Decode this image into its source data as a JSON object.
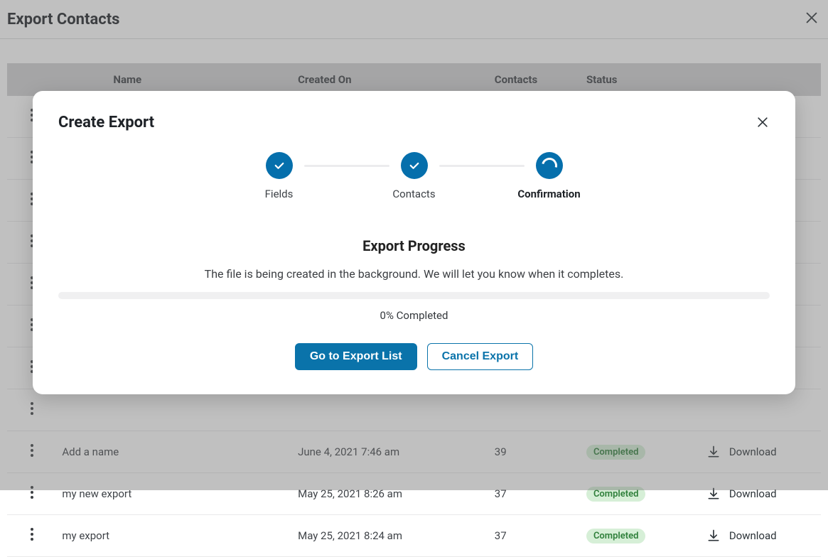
{
  "page": {
    "title": "Export Contacts"
  },
  "table": {
    "headers": {
      "name": "Name",
      "created": "Created On",
      "contacts": "Contacts",
      "status": "Status"
    },
    "rows": [
      {
        "name": "",
        "created": "",
        "contacts": "",
        "status": "",
        "download": ""
      },
      {
        "name": "",
        "created": "",
        "contacts": "",
        "status": "",
        "download": ""
      },
      {
        "name": "",
        "created": "",
        "contacts": "",
        "status": "",
        "download": ""
      },
      {
        "name": "",
        "created": "",
        "contacts": "",
        "status": "",
        "download": ""
      },
      {
        "name": "",
        "created": "",
        "contacts": "",
        "status": "",
        "download": ""
      },
      {
        "name": "",
        "created": "",
        "contacts": "",
        "status": "",
        "download": ""
      },
      {
        "name": "",
        "created": "",
        "contacts": "",
        "status": "",
        "download": ""
      },
      {
        "name": "",
        "created": "",
        "contacts": "",
        "status": "",
        "download": ""
      },
      {
        "name": "Add a name",
        "created": "June 4, 2021 7:46 am",
        "contacts": "39",
        "status": "Completed",
        "download": "Download"
      },
      {
        "name": "my new export",
        "created": "May 25, 2021 8:26 am",
        "contacts": "37",
        "status": "Completed",
        "download": "Download"
      },
      {
        "name": "my export",
        "created": "May 25, 2021 8:24 am",
        "contacts": "37",
        "status": "Completed",
        "download": "Download"
      }
    ]
  },
  "modal": {
    "title": "Create Export",
    "steps": {
      "s0": "Fields",
      "s1": "Contacts",
      "s2": "Confirmation"
    },
    "progress": {
      "title": "Export Progress",
      "description": "The file is being created in the background. We will let you know when it completes.",
      "percent_text": "0% Completed",
      "percent_value": 0
    },
    "actions": {
      "go_list": "Go to Export List",
      "cancel": "Cancel Export"
    }
  }
}
